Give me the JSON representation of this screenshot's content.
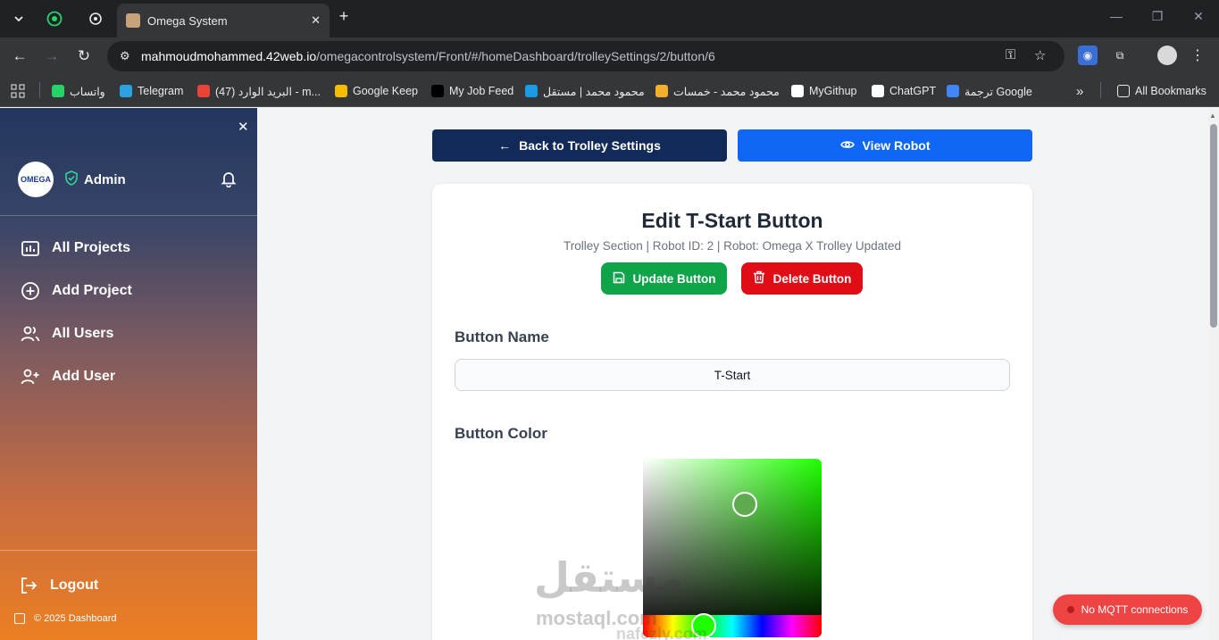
{
  "browser": {
    "tab_title": "Omega System",
    "url_host": "mahmoudmohammed.42web.io",
    "url_path": "/omegacontrolsystem/Front/#/homeDashboard/trolleySettings/2/button/6"
  },
  "bookmarks": {
    "items": [
      {
        "label": "واتساب",
        "icon": "whatsapp-icon",
        "color": "#25d366"
      },
      {
        "label": "Telegram",
        "icon": "telegram-icon",
        "color": "#2aa3e0"
      },
      {
        "label": "البريد الوارد (47) - m...",
        "icon": "gmail-icon",
        "color": "#ea4335"
      },
      {
        "label": "Google Keep",
        "icon": "keep-icon",
        "color": "#f9bb00"
      },
      {
        "label": "My Job Feed",
        "icon": "upwork-icon",
        "color": "#000000"
      },
      {
        "label": "محمود محمد | مستقل",
        "icon": "mostaql-icon",
        "color": "#1a9be6"
      },
      {
        "label": "محمود محمد - خمسات",
        "icon": "khamsat-icon",
        "color": "#f4b02a"
      },
      {
        "label": "MyGithup",
        "icon": "github-icon",
        "color": "#ffffff"
      },
      {
        "label": "ChatGPT",
        "icon": "chatgpt-icon",
        "color": "#ffffff"
      },
      {
        "label": "ترجمة Google",
        "icon": "translate-icon",
        "color": "#4285f4"
      }
    ],
    "all_bookmarks": "All Bookmarks"
  },
  "sidebar": {
    "logo_text": "OMEGA",
    "role": "Admin",
    "items": [
      {
        "label": "All Projects",
        "icon": "projects-icon"
      },
      {
        "label": "Add Project",
        "icon": "plus-circle-icon"
      },
      {
        "label": "All Users",
        "icon": "users-icon"
      },
      {
        "label": "Add User",
        "icon": "add-user-icon"
      }
    ],
    "logout": "Logout",
    "copyright": "© 2025 Dashboard"
  },
  "main": {
    "back_label": "Back to Trolley Settings",
    "view_label": "View Robot",
    "title": "Edit T-Start Button",
    "subtitle": "Trolley Section | Robot ID: 2 | Robot: Omega X Trolley Updated",
    "update_label": "Update Button",
    "delete_label": "Delete Button",
    "name_label": "Button Name",
    "name_value": "T-Start",
    "color_label": "Button Color",
    "selected_color": "#5faa4e",
    "hue_color": "#1fff00"
  },
  "mqtt": {
    "status": "No MQTT connections"
  },
  "watermark": {
    "brand": "مستقل",
    "line1": "mostaql.com",
    "line2": "nafezly.com"
  },
  "colors": {
    "primary_dark": "#112a57",
    "primary": "#1167f5",
    "success": "#0fa34a",
    "danger": "#e00c16"
  }
}
